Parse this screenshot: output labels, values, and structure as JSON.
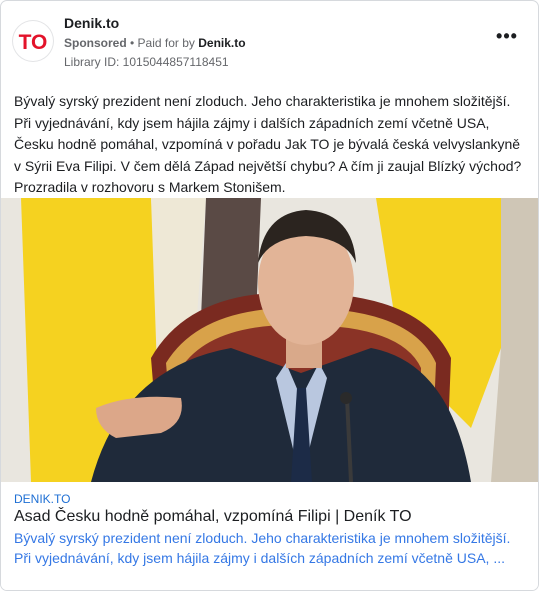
{
  "header": {
    "page_name": "Denik.to",
    "sponsored": "Sponsored",
    "separator": " • ",
    "paid_for_prefix": "Paid for by ",
    "paid_for_by": "Denik.to",
    "library_id": "Library ID: 1015044857118451",
    "menu_icon": "more-horizontal-icon",
    "logo_icon": "denik-to-logo"
  },
  "post": {
    "text": "Bývalý syrský prezident není zloduch. Jeho charakteristika je mnohem složitější. Při vyjednávání, kdy jsem hájila zájmy i dalších západních zemí včetně USA, Česku hodně pomáhal, vzpomíná v pořadu Jak TO je bývalá česká velvyslankyně v Sýrii Eva Filipi. V čem dělá Západ největší chybu? A čím ji zaujal Blízký východ? Prozradila v rozhovoru s Markem Stonišem."
  },
  "link": {
    "domain": "DENIK.TO",
    "title": "Asad Česku hodně pomáhal, vzpomíná Filipi | Deník TO",
    "desc_line1": "Bývalý syrský prezident není zloduch. Jeho charakteristika je mnohem složitější.",
    "desc_line2": "Při vyjednávání, kdy jsem hájila zájmy i dalších západních zemí včetně USA, ..."
  },
  "colors": {
    "brand_red": "#e3132a",
    "link_blue": "#3578e5",
    "domain_blue": "#1e6fd4"
  }
}
